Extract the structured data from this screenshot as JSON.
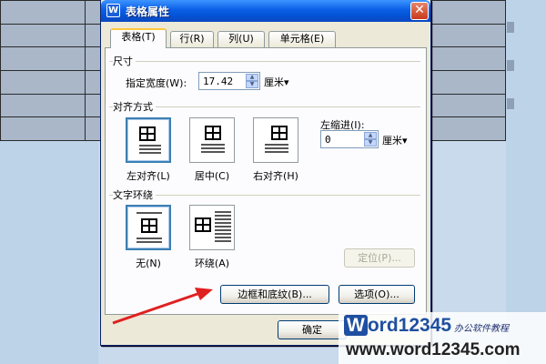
{
  "dialog": {
    "title": "表格属性",
    "app_logo": "W",
    "close_label": "✕"
  },
  "tabs": [
    {
      "label": "表格(T)"
    },
    {
      "label": "行(R)"
    },
    {
      "label": "列(U)"
    },
    {
      "label": "单元格(E)"
    }
  ],
  "size_group": {
    "title": "尺寸",
    "width_label": "指定宽度(W):",
    "width_value": "17.42",
    "unit": "厘米▾"
  },
  "align_group": {
    "title": "对齐方式",
    "options": [
      {
        "label": "左对齐(L)",
        "selected": true
      },
      {
        "label": "居中(C)",
        "selected": false
      },
      {
        "label": "右对齐(H)",
        "selected": false
      }
    ],
    "indent_label": "左缩进(I):",
    "indent_value": "0",
    "indent_unit": "厘米▾"
  },
  "wrap_group": {
    "title": "文字环绕",
    "options": [
      {
        "label": "无(N)",
        "selected": true
      },
      {
        "label": "环绕(A)",
        "selected": false
      }
    ],
    "position_button": "定位(P)..."
  },
  "buttons": {
    "borders": "边框和底纹(B)...",
    "options": "选项(O)...",
    "ok": "确定"
  },
  "watermark": {
    "logo_w": "W",
    "logo_rest": "ord12345",
    "tagline": "办公软件教程",
    "url": "www.word12345.com"
  },
  "colors": {
    "title_bar": "#0a5fe6",
    "dialog_bg": "#ece9d8",
    "arrow": "#e02020"
  }
}
